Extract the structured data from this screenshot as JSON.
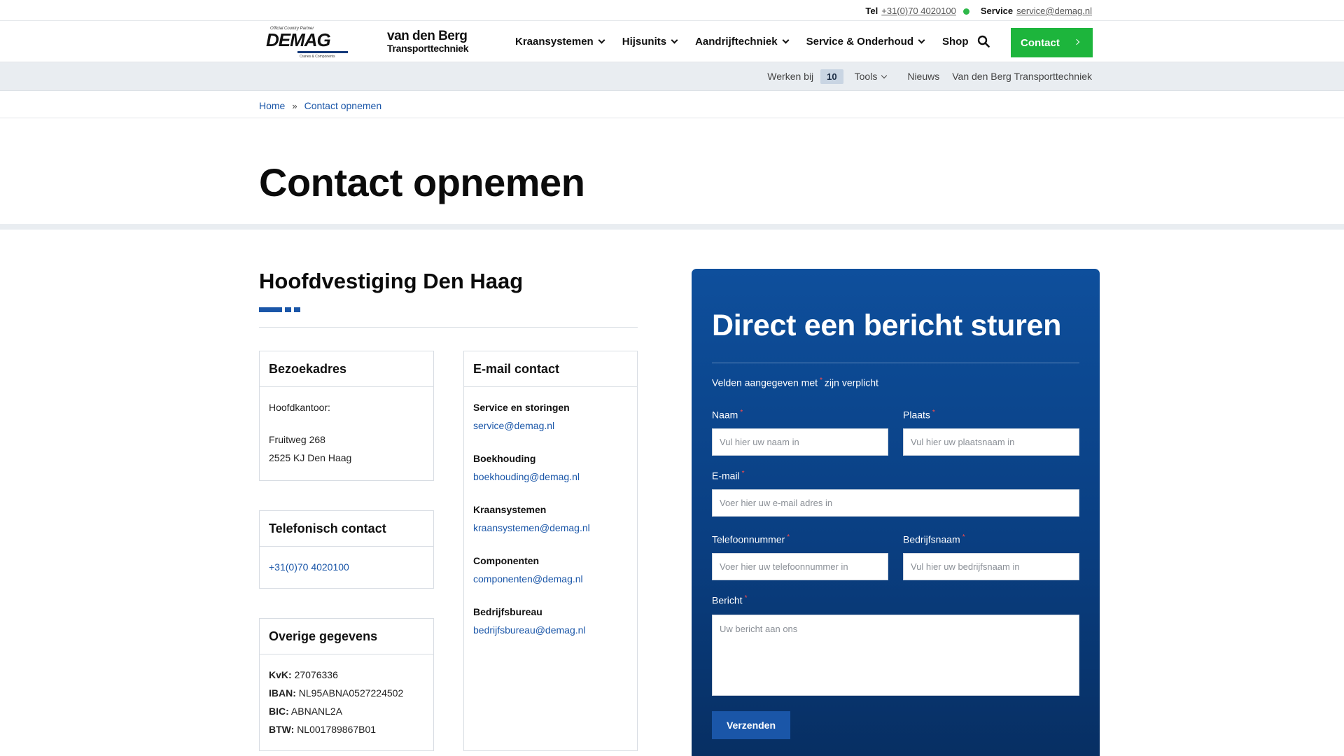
{
  "topbar": {
    "tel_label": "Tel",
    "tel_value": "+31(0)70 4020100",
    "service_label": "Service",
    "service_value": "service@demag.nl",
    "status_color": "#2fb84a"
  },
  "header": {
    "logo_demag": {
      "partner": "Official Country Partner",
      "word": "DEMAG",
      "sub": "Cranes & Components"
    },
    "logo_vdb": {
      "line1": "van den Berg",
      "line2": "Transporttechniek"
    },
    "nav": [
      {
        "label": "Kraansystemen",
        "dropdown": true
      },
      {
        "label": "Hijsunits",
        "dropdown": true
      },
      {
        "label": "Aandrijftechniek",
        "dropdown": true
      },
      {
        "label": "Service & Onderhoud",
        "dropdown": true
      },
      {
        "label": "Shop",
        "dropdown": false
      }
    ],
    "search_icon": "search-icon",
    "contact_button": "Contact",
    "accent_green": "#1db53c"
  },
  "subnav": {
    "werken_bij": "Werken bij",
    "werken_badge": "10",
    "tools": "Tools",
    "nieuws": "Nieuws",
    "vdb": "Van den Berg Transporttechniek"
  },
  "breadcrumb": {
    "home": "Home",
    "current": "Contact opnemen"
  },
  "page_title": "Contact opnemen",
  "hq": {
    "title": "Hoofdvestiging Den Haag",
    "visit": {
      "title": "Bezoekadres",
      "office": "Hoofdkantoor:",
      "street": "Fruitweg 268",
      "city": "2525 KJ Den Haag"
    },
    "phone": {
      "title": "Telefonisch contact",
      "number": "+31(0)70 4020100"
    },
    "other": {
      "title": "Overige gegevens",
      "rows": [
        {
          "label": "KvK:",
          "value": "27076336"
        },
        {
          "label": "IBAN:",
          "value": "NL95ABNA0527224502"
        },
        {
          "label": "BIC:",
          "value": "ABNANL2A"
        },
        {
          "label": "BTW:",
          "value": "NL001789867B01"
        }
      ]
    },
    "email": {
      "title": "E-mail contact",
      "groups": [
        {
          "title": "Service en storingen",
          "email": "service@demag.nl"
        },
        {
          "title": "Boekhouding",
          "email": "boekhouding@demag.nl"
        },
        {
          "title": "Kraansystemen",
          "email": "kraansystemen@demag.nl"
        },
        {
          "title": "Componenten",
          "email": "componenten@demag.nl"
        },
        {
          "title": "Bedrijfsbureau",
          "email": "bedrijfsbureau@demag.nl"
        }
      ]
    }
  },
  "form": {
    "title": "Direct een bericht sturen",
    "note_before": "Velden aangegeven met",
    "note_after": "zijn verplicht",
    "required_mark": "*",
    "fields": {
      "naam": {
        "label": "Naam",
        "placeholder": "Vul hier uw naam in"
      },
      "plaats": {
        "label": "Plaats",
        "placeholder": "Vul hier uw plaatsnaam in"
      },
      "email": {
        "label": "E-mail",
        "placeholder": "Voer hier uw e-mail adres in"
      },
      "telefoon": {
        "label": "Telefoonnummer",
        "placeholder": "Voer hier uw telefoonnummer in"
      },
      "bedrijf": {
        "label": "Bedrijfsnaam",
        "placeholder": "Vul hier uw bedrijfsnaam in"
      },
      "bericht": {
        "label": "Bericht",
        "placeholder": "Uw bericht aan ons"
      }
    },
    "submit": "Verzenden",
    "panel_color": "#0e4f9c"
  }
}
